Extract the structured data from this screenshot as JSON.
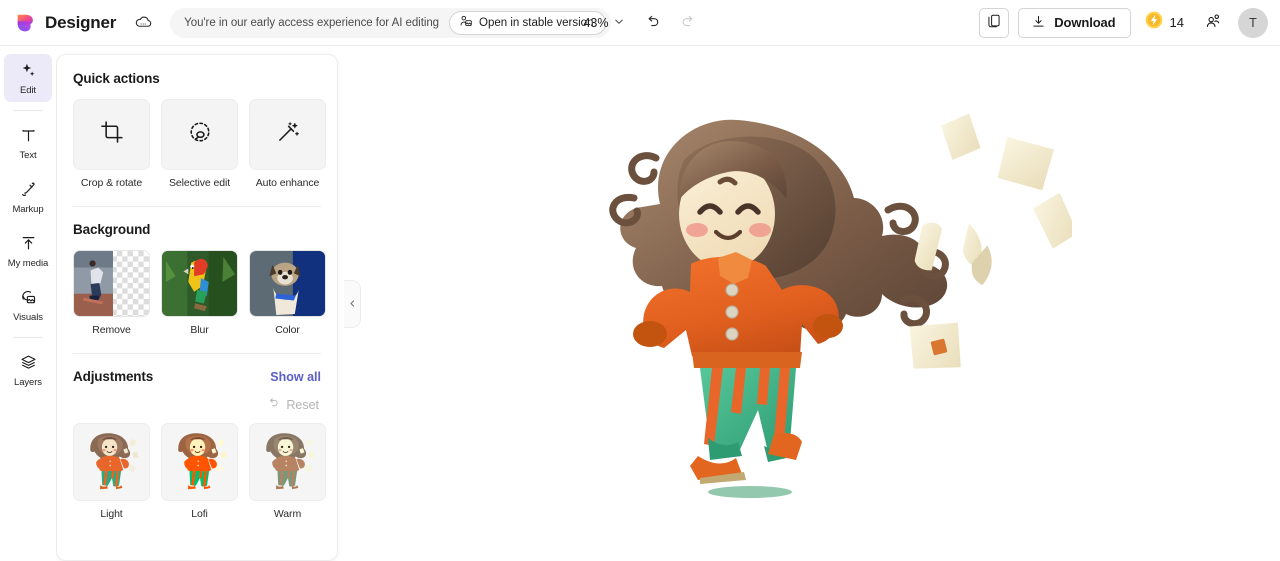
{
  "header": {
    "brand_name": "Designer",
    "logo_icon": "designer-logo",
    "cloud_icon": "cloud-icon",
    "early_access_text": "You're in our early access experience for AI editing",
    "stable_button_label": "Open in stable version",
    "stable_button_icon": "image-person-icon",
    "zoom_level": "43%",
    "zoom_chevron_icon": "chevron-down-icon",
    "undo_icon": "undo-icon",
    "redo_icon": "redo-icon",
    "copy_icon": "copy-icon",
    "download_label": "Download",
    "download_icon": "download-icon",
    "credits_icon": "lightning-coin-icon",
    "credits_count": "14",
    "share_icon": "share-people-icon",
    "avatar_initial": "T"
  },
  "rail": {
    "items": [
      {
        "label": "Edit",
        "icon": "sparkle-icon",
        "active": true
      },
      {
        "label": "Text",
        "icon": "text-icon",
        "active": false
      },
      {
        "label": "Markup",
        "icon": "pen-icon",
        "active": false
      },
      {
        "label": "My media",
        "icon": "upload-icon",
        "active": false
      },
      {
        "label": "Visuals",
        "icon": "visuals-icon",
        "active": false
      },
      {
        "label": "Layers",
        "icon": "layers-icon",
        "active": false
      }
    ]
  },
  "panel": {
    "quick_actions": {
      "title": "Quick actions",
      "items": [
        {
          "label": "Crop & rotate",
          "icon": "crop-icon"
        },
        {
          "label": "Selective edit",
          "icon": "lasso-circle-icon"
        },
        {
          "label": "Auto enhance",
          "icon": "magic-wand-icon"
        }
      ]
    },
    "background": {
      "title": "Background",
      "items": [
        {
          "label": "Remove",
          "icon": "bg-remove-thumb"
        },
        {
          "label": "Blur",
          "icon": "bg-blur-thumb"
        },
        {
          "label": "Color",
          "icon": "bg-color-thumb"
        }
      ]
    },
    "adjustments": {
      "title": "Adjustments",
      "show_all_label": "Show all",
      "reset_label": "Reset",
      "reset_icon": "undo-icon",
      "reset_disabled": true,
      "filters": [
        {
          "label": "Light"
        },
        {
          "label": "Lofi"
        },
        {
          "label": "Warm"
        }
      ]
    },
    "collapse_icon": "chevron-left-icon"
  },
  "canvas": {
    "artwork_name": "running-girl-3d-illustration",
    "background_color": "#efefef",
    "sheet_color": "#ffffff"
  },
  "colors": {
    "accent_purple": "#5b5fc7",
    "rail_active_bg": "#ece9f8",
    "rail_indicator": "#4b53d4",
    "canvas_bg": "#efefef",
    "credit_gold": "#f5c518"
  }
}
